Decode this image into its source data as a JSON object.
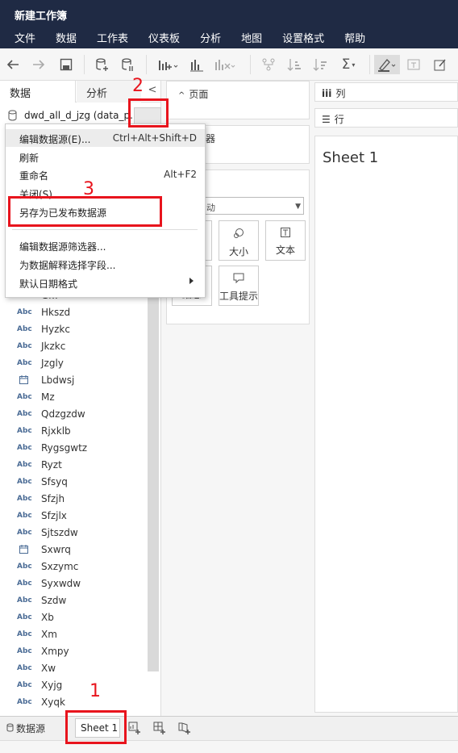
{
  "window": {
    "title": "新建工作簿"
  },
  "menubar": [
    "文件",
    "数据",
    "工作表",
    "仪表板",
    "分析",
    "地图",
    "设置格式",
    "帮助"
  ],
  "toolbar": {
    "icons": [
      "back-icon",
      "forward-icon",
      "save-icon",
      "new-datasource-icon",
      "pause-update-icon",
      "new-worksheet-icon",
      "refresh-chart-icon",
      "clear-sheet-icon",
      "swap-icon",
      "sort-asc-icon",
      "sort-desc-icon",
      "sum-icon",
      "highlight-icon",
      "label-icon",
      "annotate-icon"
    ]
  },
  "left_pane": {
    "tabs": {
      "data": "数据",
      "analysis": "分析",
      "collapse": "<"
    },
    "datasource_name": "dwd_all_d_jzg (data_p...",
    "fields": [
      {
        "type": "Abc",
        "name": "Gr.."
      },
      {
        "type": "Abc",
        "name": "Hkszd"
      },
      {
        "type": "Abc",
        "name": "Hyzkc"
      },
      {
        "type": "Abc",
        "name": "Jkzkc"
      },
      {
        "type": "Abc",
        "name": "Jzgly"
      },
      {
        "type": "date",
        "name": "Lbdwsj"
      },
      {
        "type": "Abc",
        "name": "Mz"
      },
      {
        "type": "Abc",
        "name": "Qdzgzdw"
      },
      {
        "type": "Abc",
        "name": "Rjxklb"
      },
      {
        "type": "Abc",
        "name": "Rygsgwtz"
      },
      {
        "type": "Abc",
        "name": "Ryzt"
      },
      {
        "type": "Abc",
        "name": "Sfsyq"
      },
      {
        "type": "Abc",
        "name": "Sfzjh"
      },
      {
        "type": "Abc",
        "name": "Sfzjlx"
      },
      {
        "type": "Abc",
        "name": "Sjtszdw"
      },
      {
        "type": "date",
        "name": "Sxwrq"
      },
      {
        "type": "Abc",
        "name": "Sxzymc"
      },
      {
        "type": "Abc",
        "name": "Syxwdw"
      },
      {
        "type": "Abc",
        "name": "Szdw"
      },
      {
        "type": "Abc",
        "name": "Xb"
      },
      {
        "type": "Abc",
        "name": "Xm"
      },
      {
        "type": "Abc",
        "name": "Xmpy"
      },
      {
        "type": "Abc",
        "name": "Xw"
      },
      {
        "type": "Abc",
        "name": "Xyjg"
      },
      {
        "type": "Abc",
        "name": "Xyqk"
      }
    ]
  },
  "shelves": {
    "pages": "页面",
    "filters_partial": "器",
    "marks_select_partial": "动",
    "marks_buttons": {
      "size": "大小",
      "text": "文本",
      "detail_partial": "细息",
      "tooltip": "工具提示"
    }
  },
  "view": {
    "columns_label": "列",
    "rows_label": "行",
    "sheet_title": "Sheet 1"
  },
  "context_menu": {
    "items": [
      {
        "label": "编辑数据源(E)...",
        "shortcut": "Ctrl+Alt+Shift+D"
      },
      {
        "label": "刷新",
        "shortcut": ""
      },
      {
        "label": "重命名",
        "shortcut": "Alt+F2"
      },
      {
        "label": "关闭(S)",
        "shortcut": ""
      },
      {
        "label": "另存为已发布数据源",
        "shortcut": ""
      },
      {
        "label": "编辑数据源筛选器...",
        "shortcut": ""
      },
      {
        "label": "为数据解释选择字段...",
        "shortcut": ""
      },
      {
        "label": "默认日期格式",
        "shortcut": ""
      }
    ]
  },
  "bottom_bar": {
    "datasource_tab": "数据源",
    "sheet_tab": "Sheet 1"
  },
  "annotations": {
    "step1": "1",
    "step2": "2",
    "step3": "3",
    "color": "#e8141d"
  }
}
